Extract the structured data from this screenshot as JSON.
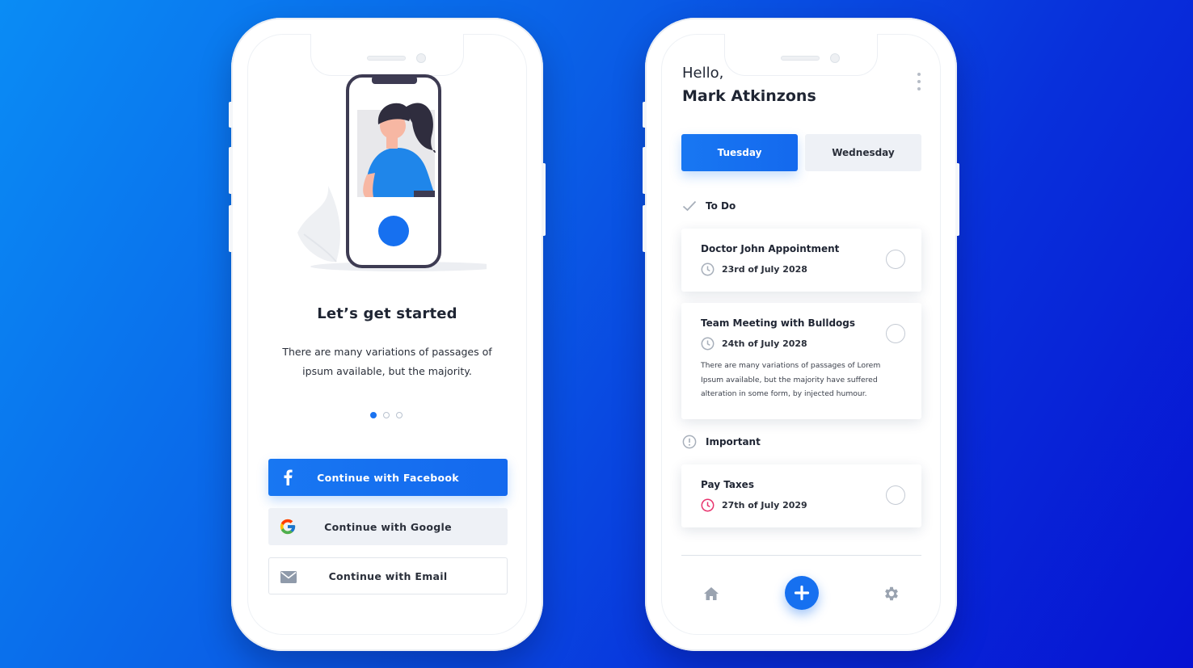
{
  "onboarding": {
    "title": "Let’s get started",
    "description": "There are many variations of passages of ipsum available, but the majority.",
    "pagination": {
      "total": 3,
      "active": 1
    },
    "buttons": {
      "facebook": "Continue with Facebook",
      "google": "Continue with Google",
      "email": "Continue with Email"
    },
    "icons": {
      "facebook": "facebook-icon",
      "google": "google-icon",
      "email": "mail-icon"
    }
  },
  "tasks": {
    "greeting": "Hello,",
    "user_name": "Mark Atkinzons",
    "tabs": [
      {
        "label": "Tuesday",
        "active": true
      },
      {
        "label": "Wednesday",
        "active": false
      }
    ],
    "sections": {
      "todo": "To Do",
      "important": "Important"
    },
    "items": [
      {
        "title": "Doctor John Appointment",
        "date": "23rd of July 2028",
        "note": ""
      },
      {
        "title": "Team Meeting with Bulldogs",
        "date": "24th of July 2028",
        "note": "There are many variations of passages of Lorem Ipsum available, but the majority have suffered alteration in some form, by injected humour."
      },
      {
        "title": "Pay Taxes",
        "date": "27th of July 2029",
        "note": ""
      }
    ],
    "nav": [
      "home-icon",
      "plus-icon",
      "gear-icon"
    ]
  },
  "colors": {
    "accent": "#1877f2",
    "background_start": "#0a8cf5",
    "background_end": "#0712d2",
    "urgent": "#e8336d",
    "muted": "#b6bcc6"
  }
}
